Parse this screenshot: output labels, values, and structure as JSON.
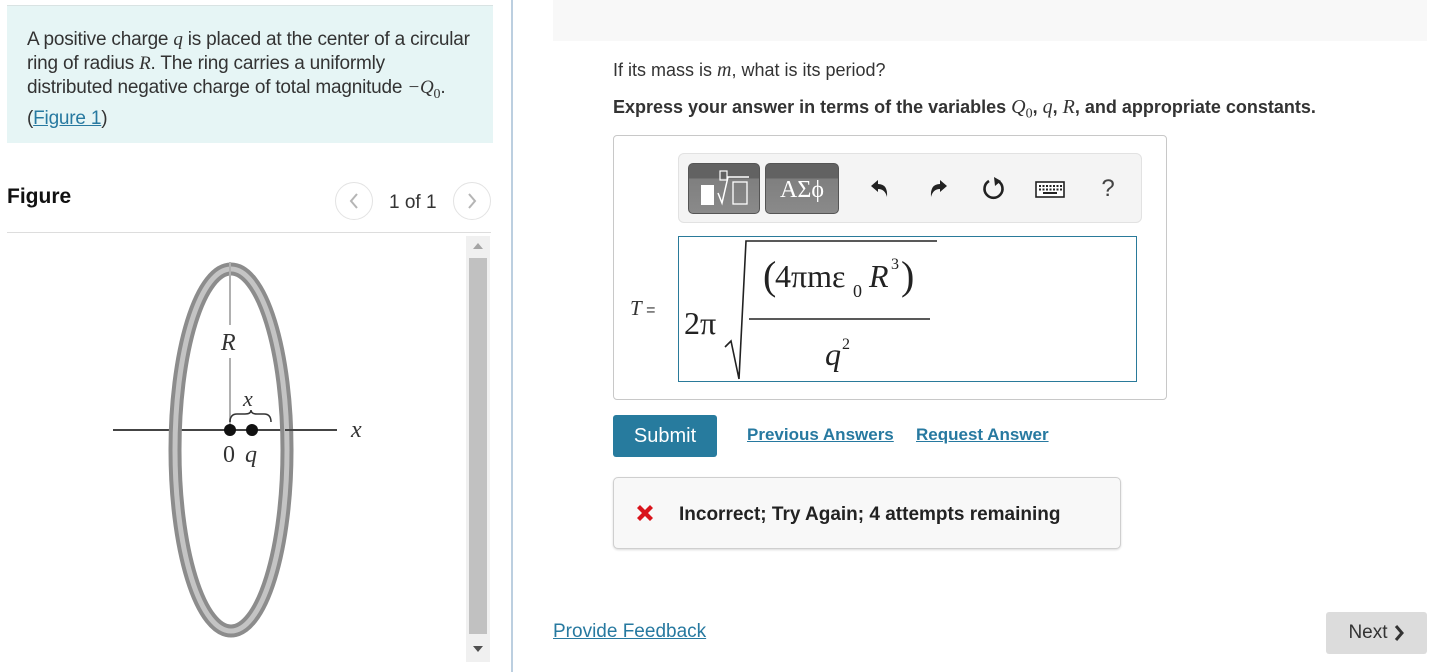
{
  "intro": {
    "text_1": "A positive charge ",
    "var_q": "q",
    "text_2": " is placed at the center of a circular ring of radius ",
    "var_R": "R",
    "text_3": ". The ring carries a uniformly distributed negative charge of total magnitude ",
    "var_neg_Q0": "−Q",
    "sub_0": "0",
    "text_4": ".(",
    "figure_link": "Figure 1",
    "text_5": ")"
  },
  "figure": {
    "title": "Figure",
    "counter": "1 of 1",
    "prev_icon": "chevron-left",
    "next_icon": "chevron-right",
    "labels": {
      "radius": "R",
      "displacement": "x",
      "origin": "0",
      "charge": "q",
      "axis": "x"
    }
  },
  "question": {
    "text_1": "If its mass is ",
    "var_m": "m",
    "text_2": ", what is its period?"
  },
  "instruction": {
    "text_1": "Express your answer in terms of the variables ",
    "var_Q": "Q",
    "sub_0": "0",
    "sep": ", ",
    "var_q": "q",
    "var_R": "R",
    "text_2": ", and appropriate constants."
  },
  "toolbar": {
    "templates_icon": "templates-sqrt",
    "symbols_label": "ΑΣϕ",
    "undo_icon": "undo",
    "redo_icon": "redo",
    "reset_icon": "reset",
    "keyboard_icon": "keyboard",
    "help_label": "?"
  },
  "answer": {
    "variable": "T",
    "equals": " =",
    "coef": "2π",
    "numerator_open": "(",
    "numerator_body": "4πmε",
    "numerator_sub": "0",
    "numerator_R": "R",
    "numerator_exp": "3",
    "numerator_close": ")",
    "denominator": "q",
    "denominator_exp": "2"
  },
  "actions": {
    "submit_label": "Submit",
    "previous_answers": "Previous Answers",
    "request_answer": "Request Answer"
  },
  "feedback": {
    "status_icon": "x-mark",
    "message": "Incorrect; Try Again; 4 attempts remaining",
    "icon_color": "#d9141c"
  },
  "footer": {
    "provide_feedback": "Provide Feedback",
    "next_label": "Next",
    "next_icon": "chevron-right"
  },
  "colors": {
    "accent": "#277b9e",
    "link": "#2779a0",
    "intro_bg": "#e6f5f5"
  }
}
